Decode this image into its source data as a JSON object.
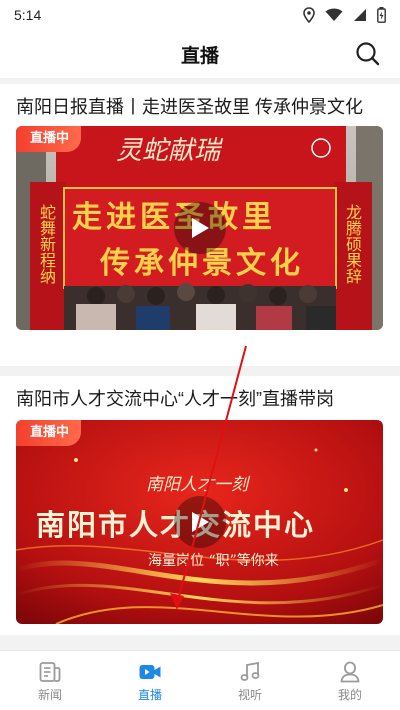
{
  "status_bar": {
    "time": "5:14",
    "icons": [
      "location-icon",
      "wifi-icon",
      "cellular-signal-icon",
      "battery-icon"
    ]
  },
  "header": {
    "title": "直播",
    "search_icon": "search-icon"
  },
  "feed": {
    "items": [
      {
        "title": "南阳日报直播丨走进医圣故里  传承仲景文化",
        "badge": "直播中",
        "thumb_text": {
          "top_calligraphy": "灵蛇献瑞",
          "line1": "走进医圣故里",
          "line2": "传承仲景文化",
          "left_couplet": "蛇舞新程纳",
          "right_couplet": "龙腾硕果辞"
        }
      },
      {
        "title": "南阳市人才交流中心“人才一刻”直播带岗",
        "badge": "直播中",
        "thumb_text": {
          "logo": "南阳人才一刻",
          "main": "南阳市人才交流中心",
          "sub": "海量岗位  “职”等你来"
        }
      }
    ]
  },
  "bottom_nav": {
    "items": [
      {
        "label": "新闻",
        "icon": "news-icon",
        "active": false
      },
      {
        "label": "直播",
        "icon": "live-video-icon",
        "active": true
      },
      {
        "label": "视听",
        "icon": "music-note-icon",
        "active": false
      },
      {
        "label": "我的",
        "icon": "profile-icon",
        "active": false
      }
    ]
  },
  "colors": {
    "accent": "#1e88e5",
    "live_badge": "#f2402f",
    "inactive": "#8a8a8a"
  }
}
